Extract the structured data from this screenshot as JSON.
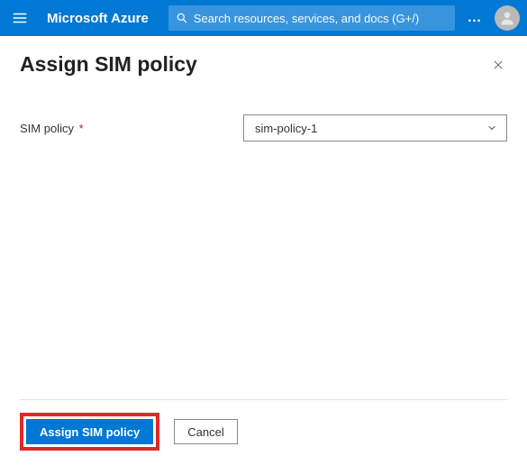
{
  "topbar": {
    "brand": "Microsoft Azure",
    "search_placeholder": "Search resources, services, and docs (G+/)",
    "more": "…"
  },
  "panel": {
    "title": "Assign SIM policy"
  },
  "form": {
    "sim_policy_label": "SIM policy",
    "sim_policy_required": "*",
    "sim_policy_value": "sim-policy-1"
  },
  "footer": {
    "assign_label": "Assign SIM policy",
    "cancel_label": "Cancel"
  }
}
